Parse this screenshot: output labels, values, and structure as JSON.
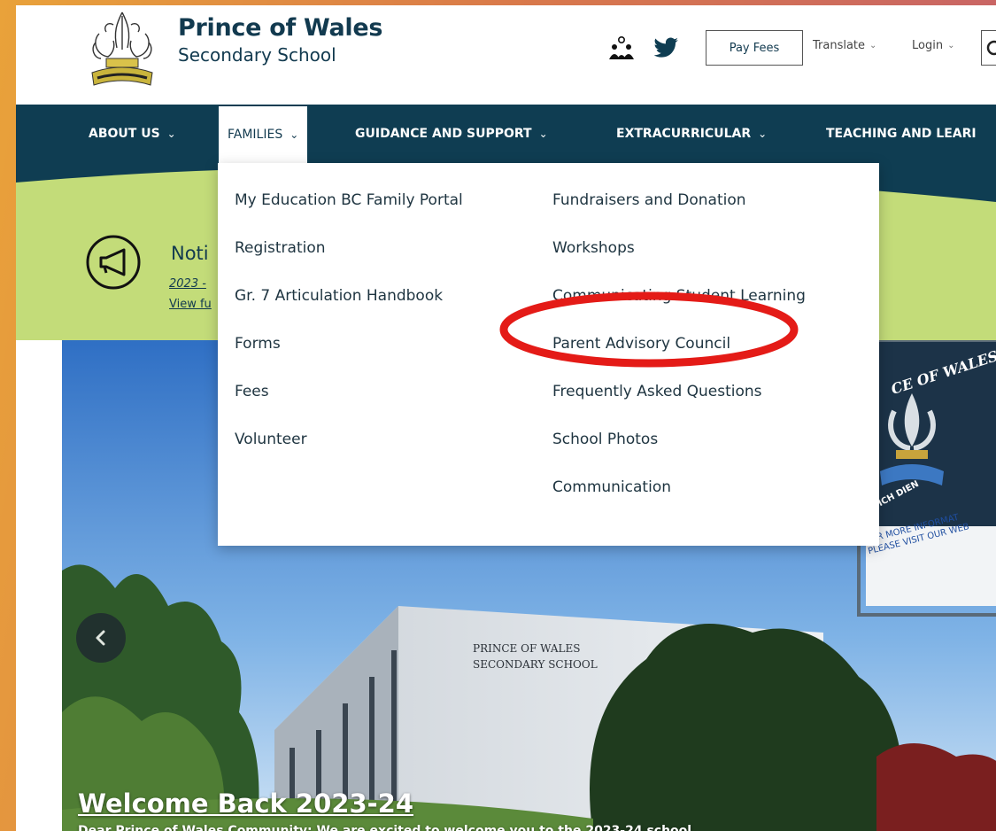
{
  "header": {
    "brand_name": "Prince of Wales",
    "brand_subtitle": "Secondary School",
    "pay_fees": "Pay Fees",
    "translate": "Translate",
    "login": "Login",
    "icons": [
      "community-icon",
      "twitter-icon",
      "search-icon"
    ]
  },
  "nav": {
    "items": [
      {
        "label": "ABOUT US"
      },
      {
        "label": "FAMILIES"
      },
      {
        "label": "GUIDANCE AND SUPPORT"
      },
      {
        "label": "EXTRACURRICULAR"
      },
      {
        "label": "TEACHING AND LEARI"
      }
    ],
    "active": "FAMILIES"
  },
  "notification": {
    "title": "Noti",
    "line1": "2023 -",
    "line2": "View fu"
  },
  "dropdown": {
    "left_column": [
      "My Education BC Family Portal",
      "Registration",
      "Gr. 7 Articulation Handbook",
      "Forms",
      "Fees",
      "Volunteer"
    ],
    "right_column": [
      "Fundraisers and Donation",
      "Workshops",
      "Communicating Student Learning",
      "Parent Advisory Council",
      "Frequently Asked Questions",
      "School Photos",
      "Communication"
    ],
    "highlighted_item": "Parent Advisory Council"
  },
  "hero": {
    "title": "Welcome Back 2023-24",
    "body_partial": "Dear Prince of Wales Community: We are excited to welcome you to the 2023-24 school",
    "building_sign": "PRINCE OF WALES\nSECONDARY SCHOOL",
    "signboard": {
      "arc_text": "CE OF WALES",
      "motto": "ICH DIEN",
      "line1": "FOR MORE INFORMAT",
      "line2": "PLEASE VISIT OUR WEB"
    }
  },
  "colors": {
    "nav_bg": "#0f3d52",
    "notify_bg": "#c3dc79",
    "brand_text": "#123a4f",
    "highlight_ring": "#e41b17"
  }
}
